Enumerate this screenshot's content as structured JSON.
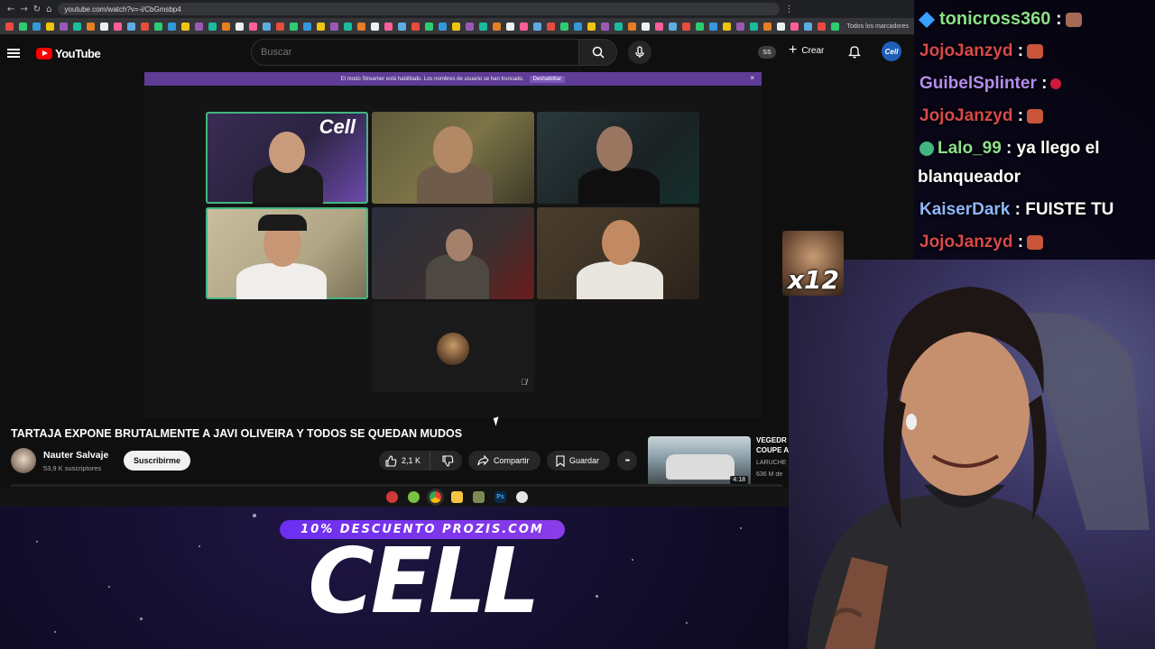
{
  "browser": {
    "url": "youtube.com/watch?v=-i/CbGmsbp4",
    "bookmarks_folder": "Todos los marcadores"
  },
  "youtube": {
    "logo_text": "YouTube",
    "search_placeholder": "Buscar",
    "ss_badge": "SS",
    "create_label": "Crear",
    "avatar_text": "Cell"
  },
  "player": {
    "streamer_notice": "El modo Streamer está habilitado. Los nombres de usuario se han truncado.",
    "streamer_disable": "Deshabilitar",
    "close_glyph": "×",
    "tile_logo": "Cell"
  },
  "video": {
    "title": "TARTAJA EXPONE BRUTALMENTE A JAVI OLIVEIRA Y TODOS SE QUEDAN MUDOS",
    "channel": "Nauter Salvaje",
    "subscribers": "53,9 K suscriptores",
    "subscribe_label": "Suscribirme",
    "likes": "2,1 K",
    "share_label": "Compartir",
    "save_label": "Guardar",
    "more_glyph": "•••"
  },
  "recommended": {
    "title_line1": "VEGEDR",
    "title_line2": "COUPE A",
    "channel": "LARUCHE",
    "views": "636 M de",
    "duration": "4:18"
  },
  "overlay": {
    "promo": "10% DESCUENTO PROZIS.COM",
    "logo": "CELL",
    "emote_count": "x12"
  },
  "chat": [
    {
      "user": "tonicross360",
      "text": ""
    },
    {
      "user": "JojoJanzyd",
      "text": ""
    },
    {
      "user": "GuibelSplinter",
      "text": ""
    },
    {
      "user": "JojoJanzyd",
      "text": ""
    },
    {
      "user": "Lalo_99",
      "text": "ya llego el"
    },
    {
      "user": "",
      "text": "blanqueador"
    },
    {
      "user": "KaiserDark",
      "text": "FUISTE TU"
    },
    {
      "user": "JojoJanzyd",
      "text": ""
    }
  ],
  "colors": {
    "youtube_red": "#ff0000",
    "streamer_bar": "#5f3c96",
    "speaker_outline": "#43b581",
    "promo_purple": "#7a35ee"
  }
}
